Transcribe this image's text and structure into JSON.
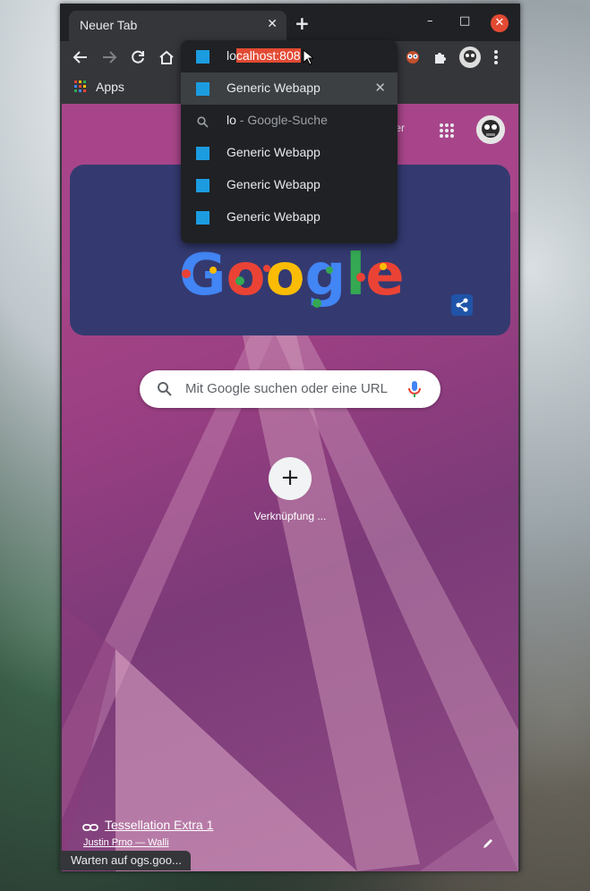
{
  "tab": {
    "title": "Neuer Tab",
    "close": "✕"
  },
  "newtab": "+",
  "window_controls": {
    "minimize": "–",
    "maximize": "□",
    "close": "✕"
  },
  "bookmarks": {
    "apps": "Apps"
  },
  "omnibox": {
    "typed_prefix": "lo",
    "completion": "calhost:808",
    "suggestions": [
      {
        "title": "Generic Webapp",
        "remove": "✕"
      },
      {
        "term": "lo",
        "separator": " - ",
        "source": "Google-Suche"
      },
      {
        "title": "Generic Webapp"
      },
      {
        "title": "Generic Webapp"
      },
      {
        "title": "Generic Webapp"
      }
    ]
  },
  "ntp": {
    "images_link": "lder",
    "search_placeholder": "Mit Google suchen oder eine URL",
    "shortcut_label": "Verknüpfung ...",
    "background_title": "Tessellation Extra 1",
    "background_credit": "Justin Prno — Walli"
  },
  "status": "Warten auf ogs.goo...",
  "colors": {
    "accent_selection": "#e34a33",
    "site_icon": "#1c9ce0",
    "close_button": "#e34a33"
  }
}
